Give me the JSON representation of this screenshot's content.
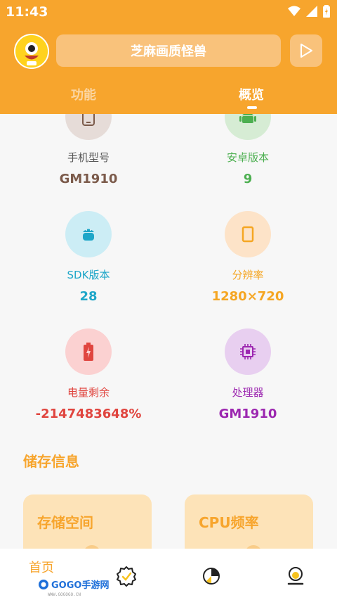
{
  "status_bar": {
    "time": "11:43"
  },
  "header": {
    "title": "芝麻画质怪兽",
    "tabs": [
      {
        "label": "功能",
        "active": false
      },
      {
        "label": "概览",
        "active": true
      }
    ]
  },
  "overview": {
    "items": [
      {
        "label": "手机型号",
        "value": "GM1910",
        "color": "#7b5a4a",
        "bg": "#e6dcd8",
        "icon": "phone-icon"
      },
      {
        "label": "安卓版本",
        "value": "9",
        "color": "#4caf50",
        "bg": "#d6ecd4",
        "icon": "android-icon"
      },
      {
        "label": "SDK版本",
        "value": "28",
        "color": "#1ea6c8",
        "bg": "#ccedf5",
        "icon": "android-sdk-icon"
      },
      {
        "label": "分辨率",
        "value": "1280×720",
        "color": "#f5a623",
        "bg": "#fde3c8",
        "icon": "screen-icon"
      },
      {
        "label": "电量剩余",
        "value": "-2147483648%",
        "color": "#e0453f",
        "bg": "#fbd1d1",
        "icon": "battery-icon"
      },
      {
        "label": "处理器",
        "value": "GM1910",
        "color": "#9c27b0",
        "bg": "#e8cff0",
        "icon": "chip-icon"
      }
    ]
  },
  "storage": {
    "section_title": "储存信息",
    "cards": [
      {
        "title": "存储空间"
      },
      {
        "title": "CPU频率"
      }
    ]
  },
  "bottom_nav": {
    "home_label": "首页",
    "items": [
      "home",
      "badge-check-icon",
      "pie-chart-icon",
      "profile-icon"
    ]
  },
  "watermark": {
    "text": "GOGO手游网",
    "sub": "WWW.GOGOGO.CN"
  },
  "colors": {
    "accent": "#f7a52d",
    "pill": "#f9c27b"
  }
}
